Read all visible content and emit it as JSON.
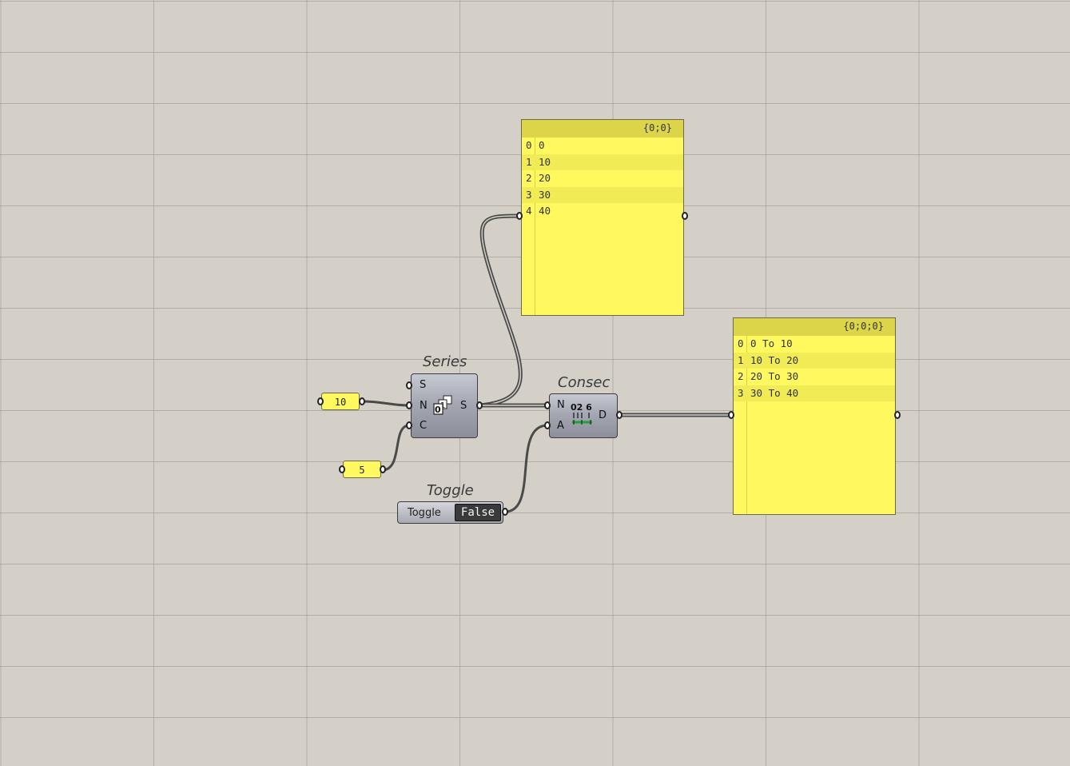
{
  "canvas": {
    "background": "#d4d0c8",
    "panel_color": "#fff95f"
  },
  "number_inputs": {
    "n_value": "10",
    "c_value": "5"
  },
  "series": {
    "caption": "Series",
    "inputs": [
      "S",
      "N",
      "C"
    ],
    "output": "S",
    "icon": "series-stack-icon"
  },
  "consec": {
    "caption": "Consec",
    "inputs": [
      "N",
      "A"
    ],
    "output": "D",
    "icon": "consecutive-domains-icon",
    "icon_text": "02 6"
  },
  "toggle": {
    "caption": "Toggle",
    "label": "Toggle",
    "value": "False"
  },
  "panel_series": {
    "path": "{0;0}",
    "rows": [
      {
        "index": "0",
        "value": "0"
      },
      {
        "index": "1",
        "value": "10"
      },
      {
        "index": "2",
        "value": "20"
      },
      {
        "index": "3",
        "value": "30"
      },
      {
        "index": "4",
        "value": "40"
      }
    ]
  },
  "panel_domains": {
    "path": "{0;0;0}",
    "rows": [
      {
        "index": "0",
        "value": "0 To 10"
      },
      {
        "index": "1",
        "value": "10 To 20"
      },
      {
        "index": "2",
        "value": "20 To 30"
      },
      {
        "index": "3",
        "value": "30 To 40"
      }
    ]
  }
}
